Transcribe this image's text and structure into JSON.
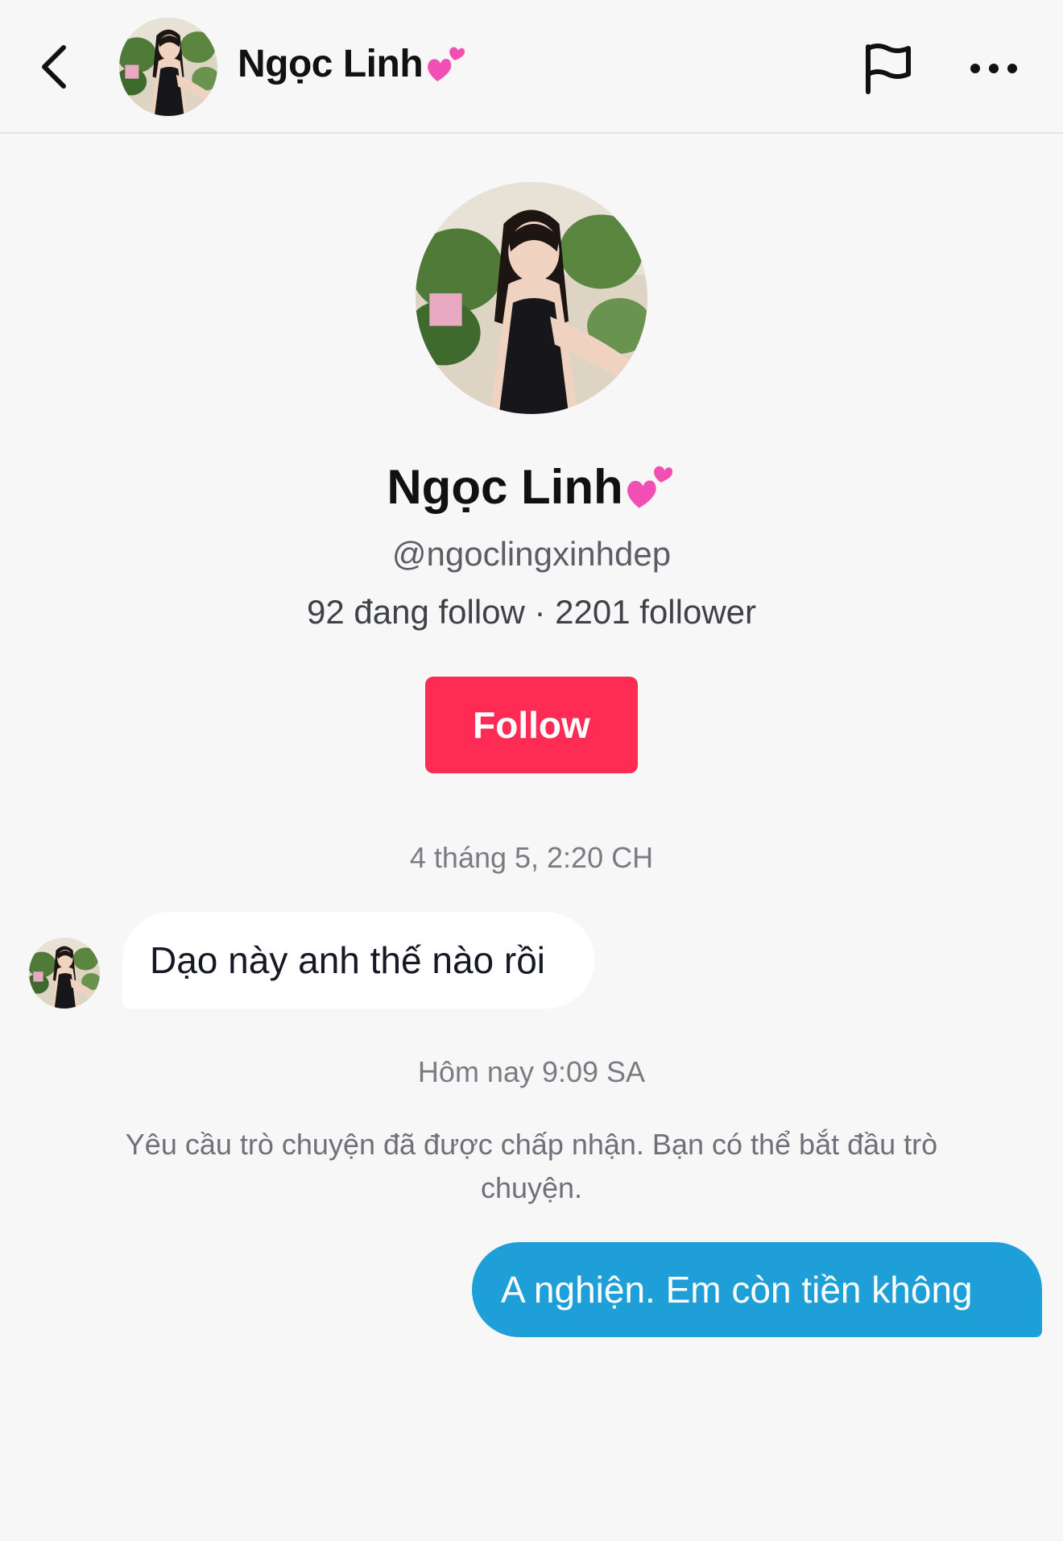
{
  "header": {
    "name": "Ngọc Linh",
    "name_emoji": "heart-icon"
  },
  "profile": {
    "name": "Ngọc Linh",
    "handle": "@ngoclingxinhdep",
    "stats": "92 đang follow · 2201 follower",
    "follow_label": "Follow"
  },
  "conversation": {
    "timestamp_1": "4 tháng 5, 2:20 CH",
    "incoming_message": "Dạo này anh thế nào rồi",
    "timestamp_2": "Hôm nay 9:09 SA",
    "system_note": "Yêu cầu trò chuyện đã được chấp nhận. Bạn có thể bắt đầu trò chuyện.",
    "outgoing_message": "A nghiện. Em còn tiền không"
  },
  "colors": {
    "follow_button": "#fe2c55",
    "outgoing_bubble": "#1f9fd8",
    "background": "#f7f7f8"
  }
}
